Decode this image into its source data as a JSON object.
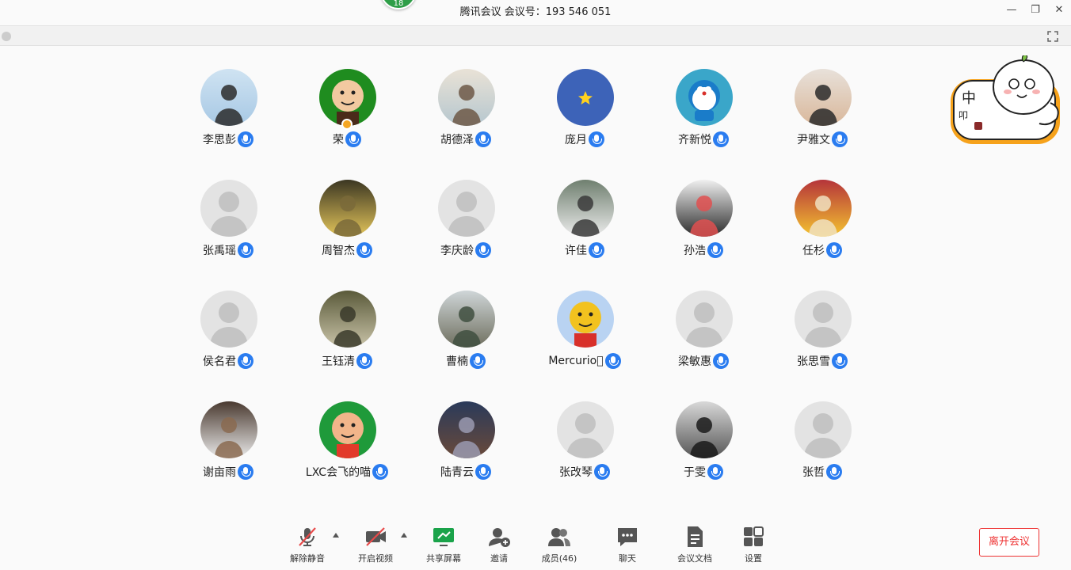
{
  "window": {
    "title": "腾讯会议 会议号：193 546 051",
    "badge": "18",
    "minimize": "—",
    "restore": "❐",
    "close": "✕"
  },
  "participants": [
    {
      "name": "李思彭",
      "avatar": "photo-sea",
      "colors": [
        "#cfe3f2",
        "#a7c8e4",
        "#2b2b2b"
      ]
    },
    {
      "name": "荣",
      "avatar": "cartoon-linus",
      "colors": [
        "#1f8c1f",
        "#f2c9a0",
        "#4a2a1a"
      ],
      "host": true
    },
    {
      "name": "胡德泽",
      "avatar": "photo-beach",
      "colors": [
        "#e9e2d6",
        "#b6c7cf",
        "#6d5846"
      ]
    },
    {
      "name": "庞月",
      "avatar": "star-blue",
      "colors": [
        "#3d63b8",
        "#ffd21f"
      ]
    },
    {
      "name": "齐新悦",
      "avatar": "doraemon",
      "colors": [
        "#3aa6c9",
        "#1a7cc9",
        "#ffffff"
      ]
    },
    {
      "name": "尹雅文",
      "avatar": "photo-girl-bunny",
      "colors": [
        "#e8e1da",
        "#d9b79a",
        "#2a2a2a"
      ]
    },
    {
      "name": "张禹瑶",
      "avatar": "default",
      "colors": [
        "#e3e3e3",
        "#c4c4c4"
      ]
    },
    {
      "name": "周智杰",
      "avatar": "photo-fire",
      "colors": [
        "#3b3622",
        "#e3c55a",
        "#7a6a3a"
      ]
    },
    {
      "name": "李庆龄",
      "avatar": "default",
      "colors": [
        "#e3e3e3",
        "#c4c4c4"
      ]
    },
    {
      "name": "许佳",
      "avatar": "photo-bride",
      "colors": [
        "#6f7f6f",
        "#ececec",
        "#3a3a3a"
      ]
    },
    {
      "name": "孙浩",
      "avatar": "photo-couple",
      "colors": [
        "#f0f0f0",
        "#2a2a2a",
        "#e05050"
      ]
    },
    {
      "name": "任杉",
      "avatar": "photo-banana-dog",
      "colors": [
        "#b5343a",
        "#f4c430",
        "#f0e0c0"
      ]
    },
    {
      "name": "侯名君",
      "avatar": "default",
      "colors": [
        "#e3e3e3",
        "#c4c4c4"
      ]
    },
    {
      "name": "王钰清",
      "avatar": "photo-tower",
      "colors": [
        "#5a5a3a",
        "#c9c3a8",
        "#3a3a2a"
      ]
    },
    {
      "name": "曹楠",
      "avatar": "photo-greatwall",
      "colors": [
        "#cfd6d8",
        "#6f6f5f",
        "#3f4f3f"
      ]
    },
    {
      "name": "Mercurio\u0000",
      "display": "Mercurio􀀀",
      "avatar": "cartoon-car",
      "colors": [
        "#b9d3f2",
        "#f2c21f",
        "#d8302a"
      ]
    },
    {
      "name": "梁敏惠",
      "avatar": "default",
      "colors": [
        "#e3e3e3",
        "#c4c4c4"
      ]
    },
    {
      "name": "张思雪",
      "avatar": "default",
      "colors": [
        "#e3e3e3",
        "#c4c4c4"
      ]
    },
    {
      "name": "谢亩雨",
      "avatar": "photo-astronaut",
      "colors": [
        "#4a3a30",
        "#eaeaea",
        "#8a6a50"
      ]
    },
    {
      "name": "LXC会飞的喵",
      "avatar": "cartoon-kid",
      "colors": [
        "#1f9a3a",
        "#f2b58a",
        "#e23a2a"
      ]
    },
    {
      "name": "陆青云",
      "avatar": "photo-basketball",
      "colors": [
        "#2a3a5a",
        "#6a4a3a",
        "#9a9ab0"
      ]
    },
    {
      "name": "张改琴",
      "avatar": "default",
      "colors": [
        "#e3e3e3",
        "#c4c4c4"
      ]
    },
    {
      "name": "于雯",
      "avatar": "photo-bw",
      "colors": [
        "#d8d8d8",
        "#555555",
        "#1a1a1a"
      ]
    },
    {
      "name": "张哲",
      "avatar": "default",
      "colors": [
        "#e3e3e3",
        "#c4c4c4"
      ]
    }
  ],
  "sticker": {
    "text1": "中",
    "text2": "叩"
  },
  "toolbar": {
    "mute_label": "解除静音",
    "video_label": "开启视频",
    "share_label": "共享屏幕",
    "invite_label": "邀请",
    "members_label": "成员(46)",
    "chat_label": "聊天",
    "docs_label": "会议文档",
    "settings_label": "设置",
    "leave_label": "离开会议"
  },
  "colors": {
    "accent": "#2a7cf0",
    "share_green": "#1aa34a",
    "leave_red": "#e33333",
    "mute_red": "#e84a4a"
  }
}
